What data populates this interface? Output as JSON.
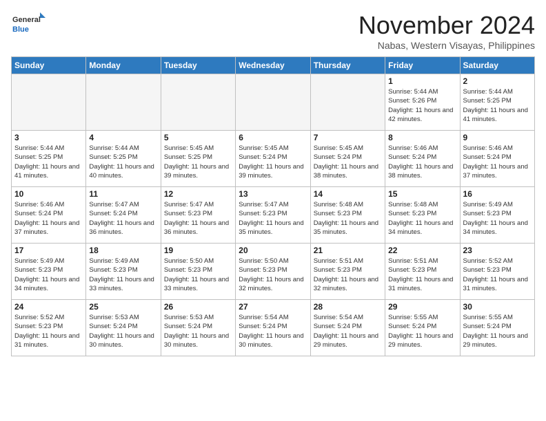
{
  "header": {
    "logo": {
      "general": "General",
      "blue": "Blue"
    },
    "title": "November 2024",
    "subtitle": "Nabas, Western Visayas, Philippines"
  },
  "weekdays": [
    "Sunday",
    "Monday",
    "Tuesday",
    "Wednesday",
    "Thursday",
    "Friday",
    "Saturday"
  ],
  "weeks": [
    [
      {
        "day": "",
        "empty": true
      },
      {
        "day": "",
        "empty": true
      },
      {
        "day": "",
        "empty": true
      },
      {
        "day": "",
        "empty": true
      },
      {
        "day": "",
        "empty": true
      },
      {
        "day": "1",
        "sunrise": "5:44 AM",
        "sunset": "5:26 PM",
        "daylight": "11 hours and 42 minutes."
      },
      {
        "day": "2",
        "sunrise": "5:44 AM",
        "sunset": "5:25 PM",
        "daylight": "11 hours and 41 minutes."
      }
    ],
    [
      {
        "day": "3",
        "sunrise": "5:44 AM",
        "sunset": "5:25 PM",
        "daylight": "11 hours and 41 minutes."
      },
      {
        "day": "4",
        "sunrise": "5:44 AM",
        "sunset": "5:25 PM",
        "daylight": "11 hours and 40 minutes."
      },
      {
        "day": "5",
        "sunrise": "5:45 AM",
        "sunset": "5:25 PM",
        "daylight": "11 hours and 39 minutes."
      },
      {
        "day": "6",
        "sunrise": "5:45 AM",
        "sunset": "5:24 PM",
        "daylight": "11 hours and 39 minutes."
      },
      {
        "day": "7",
        "sunrise": "5:45 AM",
        "sunset": "5:24 PM",
        "daylight": "11 hours and 38 minutes."
      },
      {
        "day": "8",
        "sunrise": "5:46 AM",
        "sunset": "5:24 PM",
        "daylight": "11 hours and 38 minutes."
      },
      {
        "day": "9",
        "sunrise": "5:46 AM",
        "sunset": "5:24 PM",
        "daylight": "11 hours and 37 minutes."
      }
    ],
    [
      {
        "day": "10",
        "sunrise": "5:46 AM",
        "sunset": "5:24 PM",
        "daylight": "11 hours and 37 minutes."
      },
      {
        "day": "11",
        "sunrise": "5:47 AM",
        "sunset": "5:24 PM",
        "daylight": "11 hours and 36 minutes."
      },
      {
        "day": "12",
        "sunrise": "5:47 AM",
        "sunset": "5:23 PM",
        "daylight": "11 hours and 36 minutes."
      },
      {
        "day": "13",
        "sunrise": "5:47 AM",
        "sunset": "5:23 PM",
        "daylight": "11 hours and 35 minutes."
      },
      {
        "day": "14",
        "sunrise": "5:48 AM",
        "sunset": "5:23 PM",
        "daylight": "11 hours and 35 minutes."
      },
      {
        "day": "15",
        "sunrise": "5:48 AM",
        "sunset": "5:23 PM",
        "daylight": "11 hours and 34 minutes."
      },
      {
        "day": "16",
        "sunrise": "5:49 AM",
        "sunset": "5:23 PM",
        "daylight": "11 hours and 34 minutes."
      }
    ],
    [
      {
        "day": "17",
        "sunrise": "5:49 AM",
        "sunset": "5:23 PM",
        "daylight": "11 hours and 34 minutes."
      },
      {
        "day": "18",
        "sunrise": "5:49 AM",
        "sunset": "5:23 PM",
        "daylight": "11 hours and 33 minutes."
      },
      {
        "day": "19",
        "sunrise": "5:50 AM",
        "sunset": "5:23 PM",
        "daylight": "11 hours and 33 minutes."
      },
      {
        "day": "20",
        "sunrise": "5:50 AM",
        "sunset": "5:23 PM",
        "daylight": "11 hours and 32 minutes."
      },
      {
        "day": "21",
        "sunrise": "5:51 AM",
        "sunset": "5:23 PM",
        "daylight": "11 hours and 32 minutes."
      },
      {
        "day": "22",
        "sunrise": "5:51 AM",
        "sunset": "5:23 PM",
        "daylight": "11 hours and 31 minutes."
      },
      {
        "day": "23",
        "sunrise": "5:52 AM",
        "sunset": "5:23 PM",
        "daylight": "11 hours and 31 minutes."
      }
    ],
    [
      {
        "day": "24",
        "sunrise": "5:52 AM",
        "sunset": "5:23 PM",
        "daylight": "11 hours and 31 minutes."
      },
      {
        "day": "25",
        "sunrise": "5:53 AM",
        "sunset": "5:24 PM",
        "daylight": "11 hours and 30 minutes."
      },
      {
        "day": "26",
        "sunrise": "5:53 AM",
        "sunset": "5:24 PM",
        "daylight": "11 hours and 30 minutes."
      },
      {
        "day": "27",
        "sunrise": "5:54 AM",
        "sunset": "5:24 PM",
        "daylight": "11 hours and 30 minutes."
      },
      {
        "day": "28",
        "sunrise": "5:54 AM",
        "sunset": "5:24 PM",
        "daylight": "11 hours and 29 minutes."
      },
      {
        "day": "29",
        "sunrise": "5:55 AM",
        "sunset": "5:24 PM",
        "daylight": "11 hours and 29 minutes."
      },
      {
        "day": "30",
        "sunrise": "5:55 AM",
        "sunset": "5:24 PM",
        "daylight": "11 hours and 29 minutes."
      }
    ]
  ]
}
